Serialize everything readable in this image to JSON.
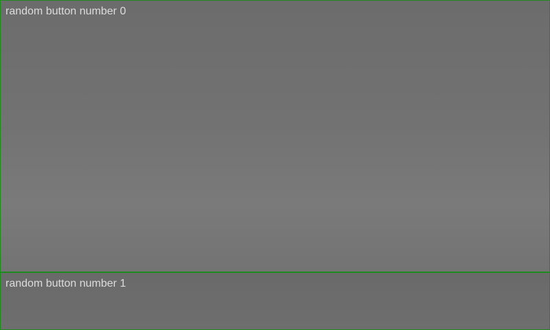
{
  "buttons": [
    {
      "label": "random button number 0"
    },
    {
      "label": "random button number 1"
    }
  ],
  "colors": {
    "border": "#1f8a1f",
    "button_fill": "#727272",
    "label_text": "#dcdcdc"
  }
}
